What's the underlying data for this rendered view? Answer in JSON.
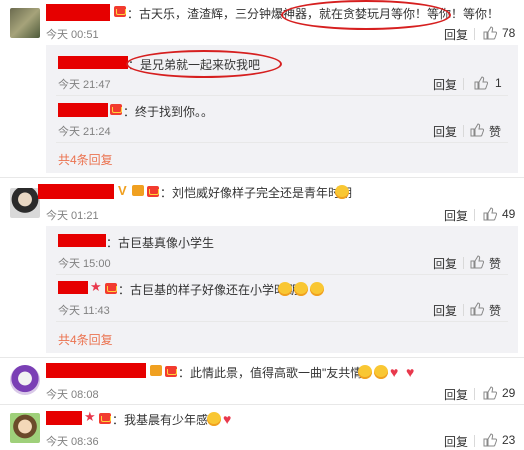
{
  "comments": [
    {
      "text": "：古天乐，渣渣辉，三分钟爆神器，就在贪婪玩月等你！等你！等你！",
      "time": "今天 00:51",
      "reply": "回复",
      "likes": "78",
      "replies": [
        {
          "text": "：是兄弟就一起来砍我吧",
          "time": "今天 21:47",
          "reply": "回复",
          "likes": "1"
        },
        {
          "text": "：终于找到你。。",
          "time": "今天 21:24",
          "reply": "回复",
          "likes": "赞"
        }
      ],
      "more": "共4条回复"
    },
    {
      "text": "：刘恺威好像样子完全还是青年时期",
      "time": "今天 01:21",
      "reply": "回复",
      "likes": "49",
      "replies": [
        {
          "text": "：古巨基真像小学生",
          "time": "今天 15:00",
          "reply": "回复",
          "likes": "赞"
        },
        {
          "text": "：古巨基的样子好像还在小学时期",
          "time": "今天 11:43",
          "reply": "回复",
          "likes": "赞"
        }
      ],
      "more": "共4条回复"
    },
    {
      "text": "：此情此景，值得高歌一曲\"友共情\"！",
      "time": "今天 08:08",
      "reply": "回复",
      "likes": "29"
    },
    {
      "text": "：我基晨有少年感！",
      "time": "今天 08:36",
      "reply": "回复",
      "likes": "23"
    }
  ],
  "colors": {
    "redaction": "#e60000",
    "link": "#eb7350",
    "annotation": "#d61f1f"
  },
  "icons": {
    "like": "thumbs-up-icon",
    "vip": "crown-badge-icon"
  }
}
